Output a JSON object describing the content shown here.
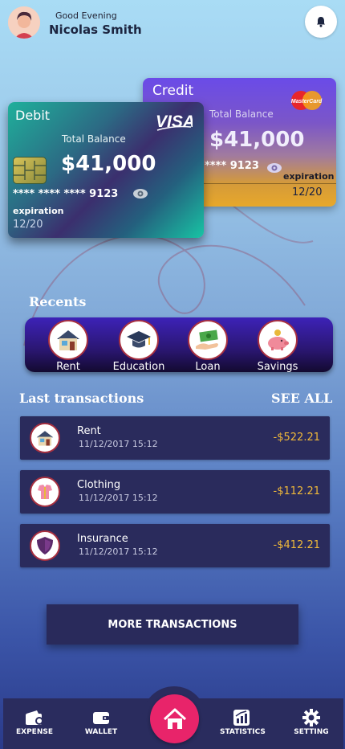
{
  "header": {
    "greeting": "Good Evening",
    "user_name": "Nicolas Smith",
    "avatar_icon": "avatar-icon",
    "notification_icon": "bell-icon"
  },
  "cards": {
    "credit": {
      "title": "Credit",
      "balance_label": "Total Balance",
      "balance": "$41,000",
      "number": "**** 9123",
      "expiration_label": "expiration",
      "expiration": "12/20",
      "brand": "MasterCard"
    },
    "debit": {
      "title": "Debit",
      "balance_label": "Total Balance",
      "balance": "$41,000",
      "number": "**** **** **** 9123",
      "expiration_label": "expiration",
      "expiration": "12/20",
      "brand": "VISA"
    }
  },
  "recents": {
    "title": "Recents",
    "items": [
      {
        "label": "Rent",
        "icon": "house-icon"
      },
      {
        "label": "Education",
        "icon": "graduation-cap-icon"
      },
      {
        "label": "Loan",
        "icon": "money-hand-icon"
      },
      {
        "label": "Savings",
        "icon": "piggy-bank-icon"
      }
    ]
  },
  "transactions": {
    "title": "Last transactions",
    "see_all": "SEE ALL",
    "items": [
      {
        "name": "Rent",
        "date": "11/12/2017 15:12",
        "amount": "-$522.21",
        "icon": "house-icon"
      },
      {
        "name": "Clothing",
        "date": "11/12/2017 15:12",
        "amount": "-$112.21",
        "icon": "clothing-icon"
      },
      {
        "name": "Insurance",
        "date": "11/12/2017 15:12",
        "amount": "-$412.21",
        "icon": "shield-icon"
      }
    ],
    "more_label": "MORE TRANSACTIONS"
  },
  "nav": {
    "items": [
      {
        "label": "EXPENSE",
        "icon": "wallet-card-icon"
      },
      {
        "label": "WALLET",
        "icon": "wallet-icon"
      },
      {
        "label": "STATISTICS",
        "icon": "chart-icon"
      },
      {
        "label": "SETTING",
        "icon": "gear-icon"
      }
    ],
    "home_icon": "home-icon"
  },
  "colors": {
    "amount": "#f0b93a",
    "home_button": "#e8246a",
    "card_dark": "#2a2b5c"
  }
}
